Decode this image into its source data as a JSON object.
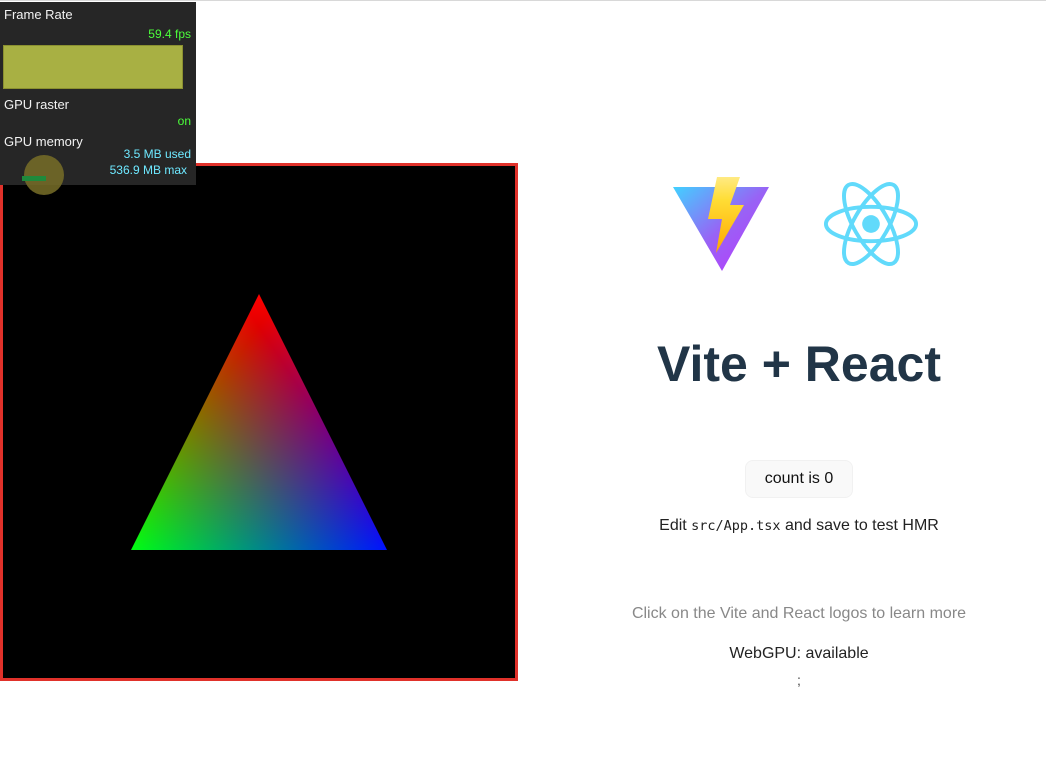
{
  "stats": {
    "frame_rate_label": "Frame Rate",
    "frame_rate_value": "59.4 fps",
    "gpu_raster_label": "GPU raster",
    "gpu_raster_value": "on",
    "gpu_memory_label": "GPU memory",
    "gpu_memory_used": "3.5 MB used",
    "gpu_memory_max": "536.9 MB max",
    "colors": {
      "green": "#4cff3b",
      "cyan": "#6ee8ff",
      "graph": "#a8b043"
    }
  },
  "canvas": {
    "border_color": "#e0312a",
    "triangle_vertex_colors": [
      "#ff0000",
      "#00ff00",
      "#0000ff"
    ]
  },
  "app": {
    "title": "Vite + React",
    "logos": [
      "vite-logo",
      "react-logo"
    ],
    "count_button": "count is 0",
    "edit_prefix": "Edit ",
    "edit_code": "src/App.tsx",
    "edit_suffix": " and save to test HMR",
    "read_docs": "Click on the Vite and React logos to learn more",
    "webgpu_status": "WebGPU: available",
    "trailing_text": ";",
    "colors": {
      "title": "#213547",
      "react": "#61dafb"
    }
  }
}
